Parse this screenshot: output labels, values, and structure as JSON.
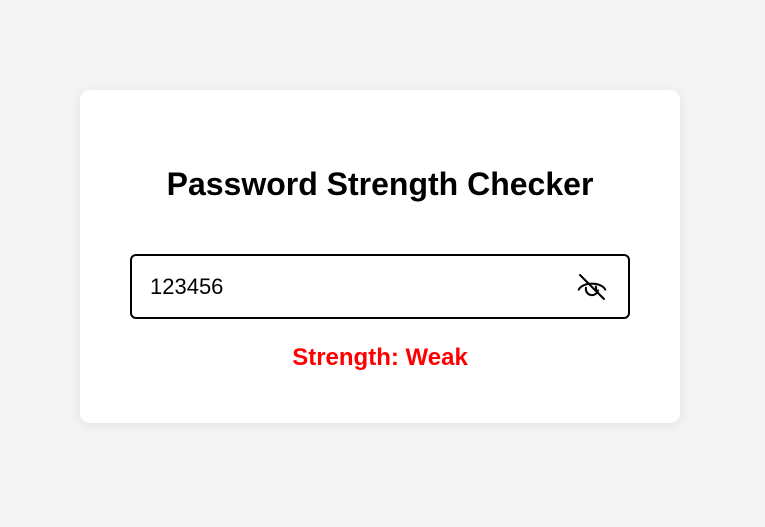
{
  "card": {
    "title": "Password Strength Checker"
  },
  "password_field": {
    "value": "123456",
    "toggle_icon": "eye-off-icon"
  },
  "strength": {
    "label": "Strength: Weak",
    "color": "#ff0000"
  }
}
